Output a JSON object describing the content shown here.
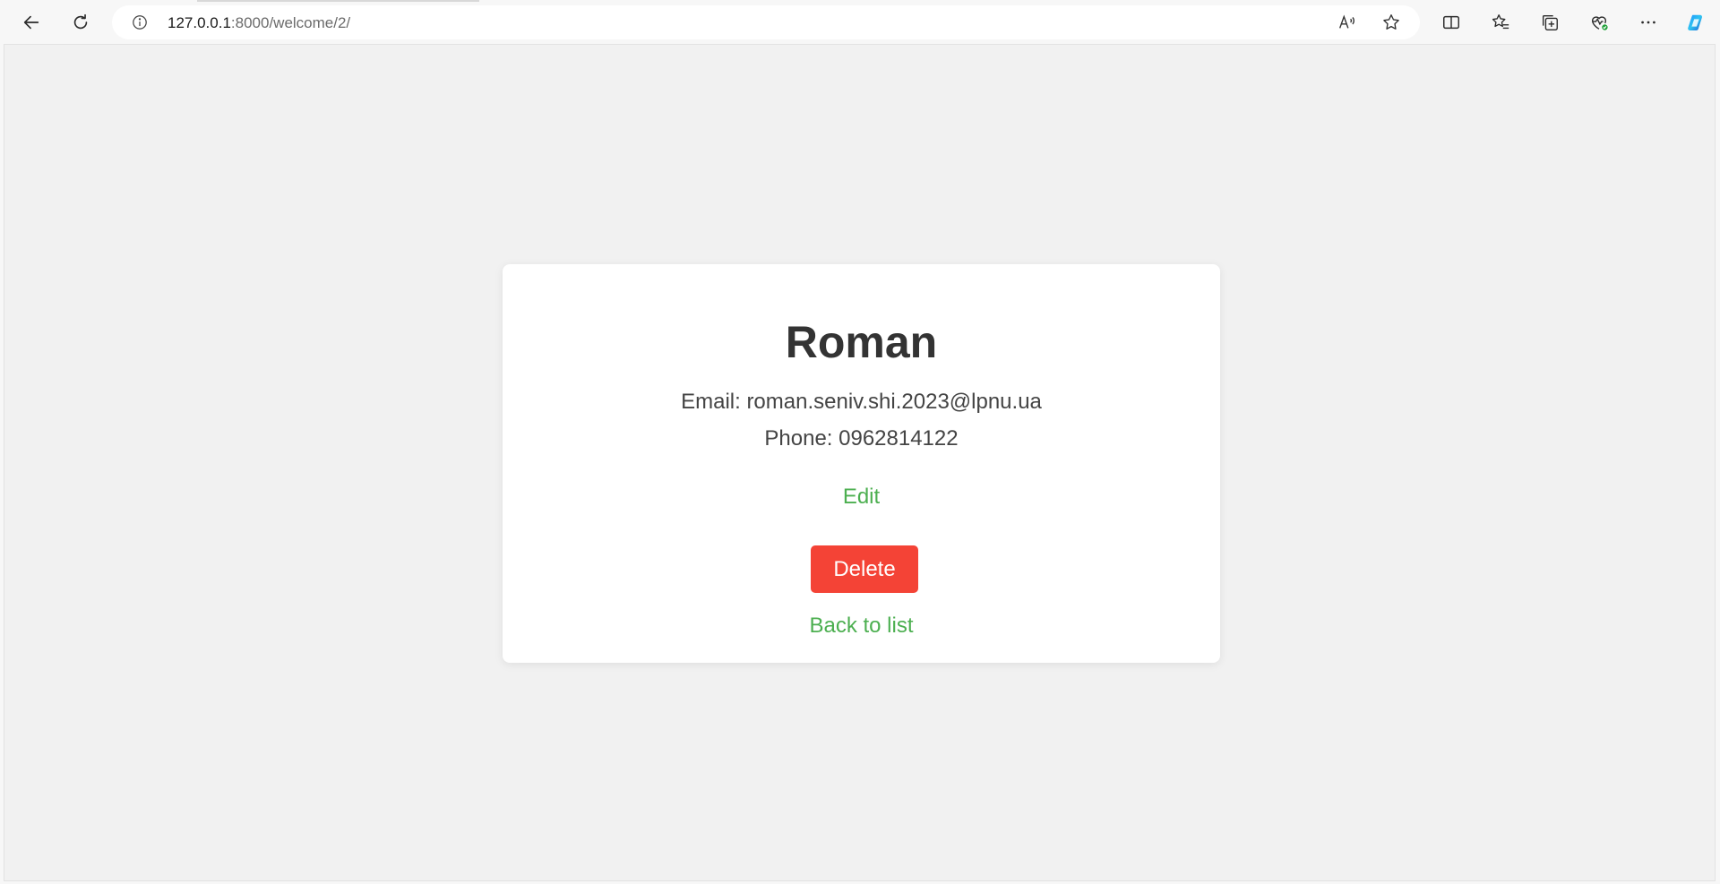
{
  "browser": {
    "url_host": "127.0.0.1",
    "url_path": ":8000/welcome/2/"
  },
  "user": {
    "name": "Roman",
    "email_line": "Email: roman.seniv.shi.2023@lpnu.ua",
    "phone_line": "Phone: 0962814122"
  },
  "actions": {
    "edit_label": "Edit",
    "delete_label": "Delete",
    "back_label": "Back to list"
  },
  "colors": {
    "link_green": "#4caf50",
    "delete_red": "#f44336",
    "text_dark": "#333333"
  }
}
